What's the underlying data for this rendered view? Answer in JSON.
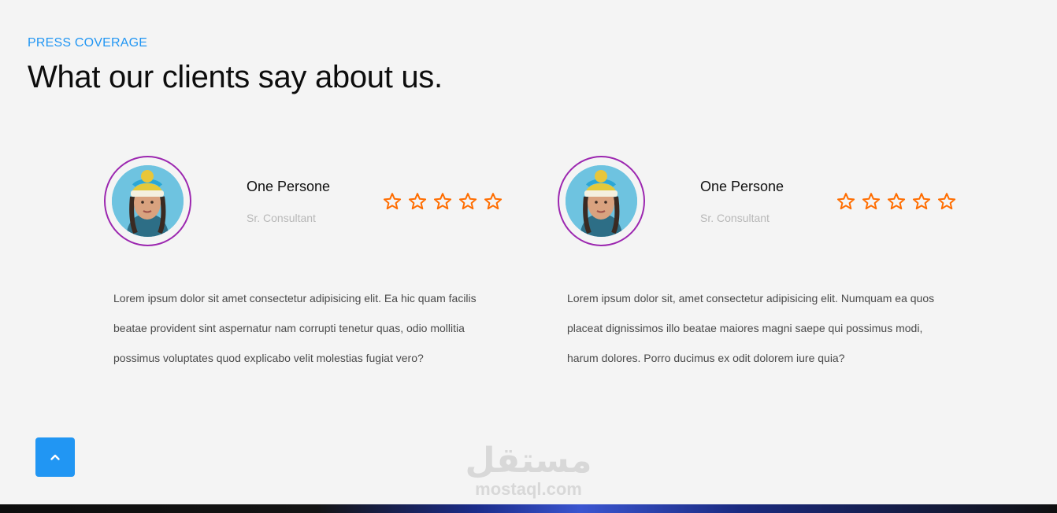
{
  "section": {
    "eyebrow": "PRESS COVERAGE",
    "title": "What our clients say about us."
  },
  "testimonials": [
    {
      "name": "One Persone",
      "role": "Sr. Consultant",
      "rating": 0,
      "rating_max": 5,
      "quote": "Lorem ipsum dolor sit amet consectetur adipisicing elit. Ea hic quam facilis beatae provident sint aspernatur nam corrupti tenetur quas, odio mollitia possimus voluptates quod explicabo velit molestias fugiat vero?"
    },
    {
      "name": "One Persone",
      "role": "Sr. Consultant",
      "rating": 0,
      "rating_max": 5,
      "quote": "Lorem ipsum dolor sit, amet consectetur adipisicing elit. Numquam ea quos placeat dignissimos illo beatae maiores magni saepe qui possimus modi, harum dolores. Porro ducimus ex odit dolorem iure quia?"
    }
  ],
  "watermark": {
    "arabic": "مستقل",
    "latin": "mostaql.com"
  },
  "icons": {
    "scroll_top": "chevron-up-icon",
    "star": "star-outline-icon"
  },
  "colors": {
    "accent": "#2196f3",
    "avatar_ring": "#9c27b0",
    "star": "#ff6d00"
  }
}
